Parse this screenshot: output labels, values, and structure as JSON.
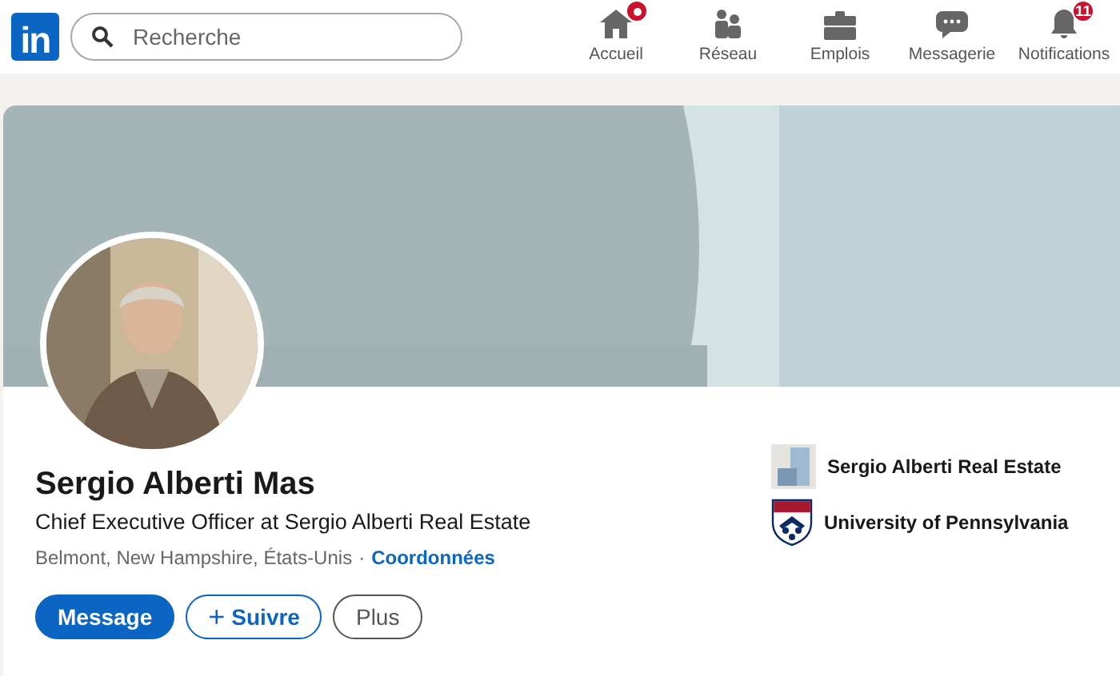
{
  "nav": {
    "logo": "in",
    "search": {
      "placeholder": "Recherche"
    },
    "items": [
      {
        "kind": "home",
        "label": "Accueil",
        "dot": true
      },
      {
        "kind": "network",
        "label": "Réseau"
      },
      {
        "kind": "jobs",
        "label": "Emplois"
      },
      {
        "kind": "messages",
        "label": "Messagerie"
      },
      {
        "kind": "bell",
        "label": "Notifications",
        "badge": "11"
      }
    ]
  },
  "profile": {
    "name": "Sergio Alberti Mas",
    "headline": "Chief Executive Officer at Sergio Alberti Real Estate",
    "location": "Belmont, New Hampshire, États-Unis",
    "separator": "·",
    "contact_link": "Coordonnées",
    "actions": [
      {
        "kind": "primary",
        "label": "Message"
      },
      {
        "kind": "outline",
        "label": "Suivre",
        "icon": "+"
      },
      {
        "kind": "secondary",
        "label": "Plus"
      }
    ],
    "affiliations": [
      {
        "kind": "company",
        "label": "Sergio Alberti Real Estate"
      },
      {
        "kind": "school",
        "label": "University of Pennsylvania"
      }
    ]
  }
}
